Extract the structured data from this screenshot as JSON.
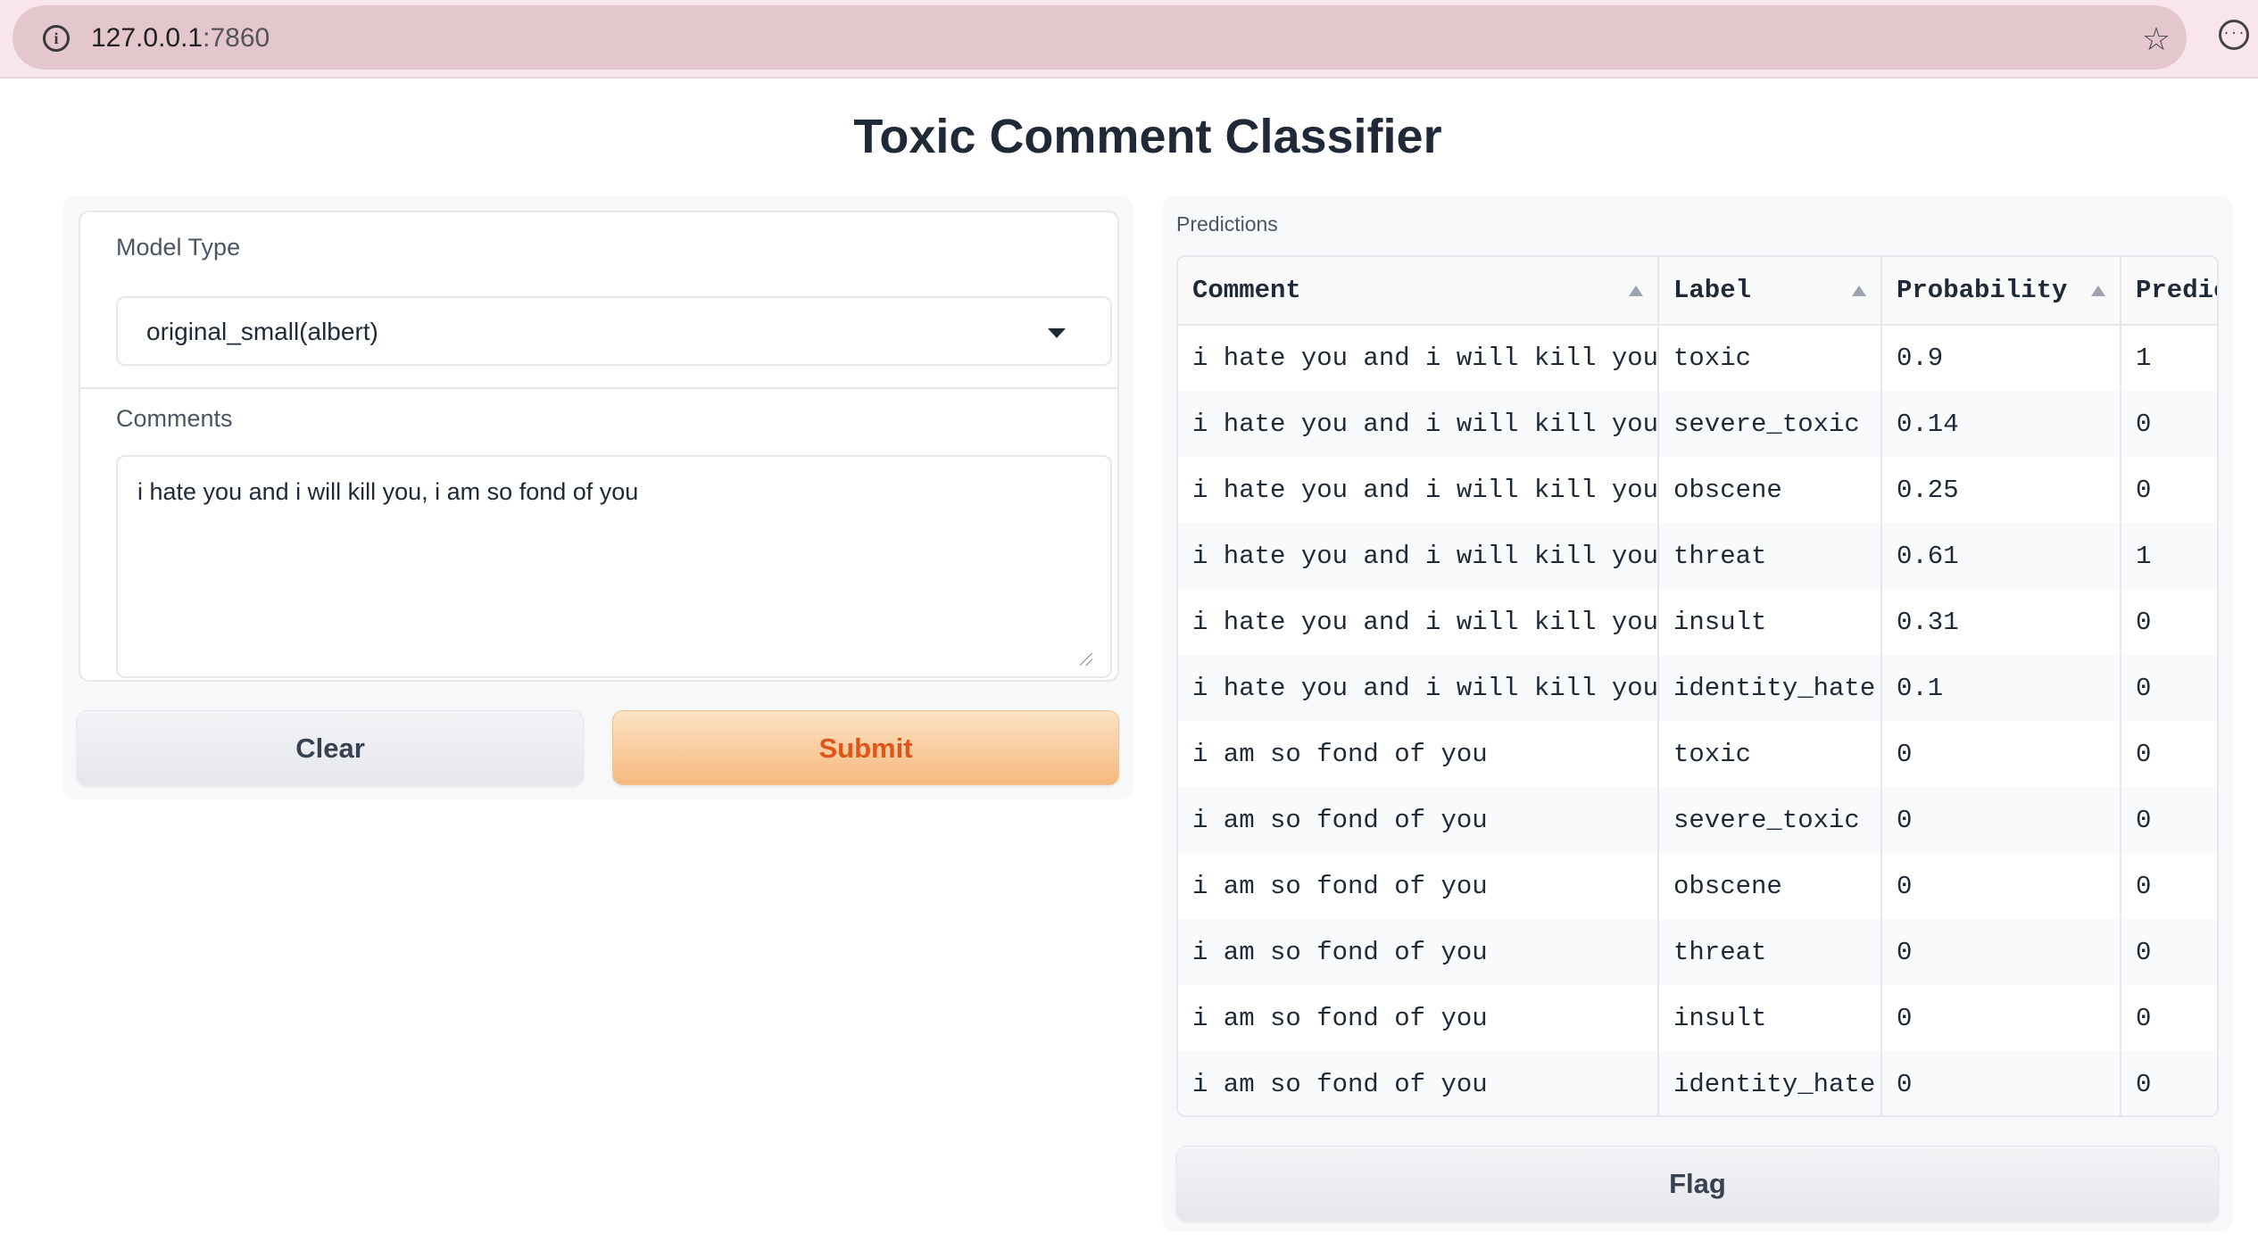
{
  "browser": {
    "url_host": "127.0.0.1",
    "url_port": ":7860"
  },
  "app": {
    "title": "Toxic Comment Classifier"
  },
  "form": {
    "model_label": "Model Type",
    "model_value": "original_small(albert)",
    "comments_label": "Comments",
    "comments_value": "i hate you and i will kill you, i am so fond of you",
    "clear_label": "Clear",
    "submit_label": "Submit"
  },
  "predictions": {
    "label": "Predictions",
    "columns": [
      "Comment",
      "Label",
      "Probability",
      "Predic"
    ],
    "rows": [
      [
        "i hate you and i will kill you",
        "toxic",
        "0.9",
        "1"
      ],
      [
        "i hate you and i will kill you",
        "severe_toxic",
        "0.14",
        "0"
      ],
      [
        "i hate you and i will kill you",
        "obscene",
        "0.25",
        "0"
      ],
      [
        "i hate you and i will kill you",
        "threat",
        "0.61",
        "1"
      ],
      [
        "i hate you and i will kill you",
        "insult",
        "0.31",
        "0"
      ],
      [
        "i hate you and i will kill you",
        "identity_hate",
        "0.1",
        "0"
      ],
      [
        "i am so fond of you",
        "toxic",
        "0",
        "0"
      ],
      [
        "i am so fond of you",
        "severe_toxic",
        "0",
        "0"
      ],
      [
        "i am so fond of you",
        "obscene",
        "0",
        "0"
      ],
      [
        "i am so fond of you",
        "threat",
        "0",
        "0"
      ],
      [
        "i am so fond of you",
        "insult",
        "0",
        "0"
      ],
      [
        "i am so fond of you",
        "identity_hate",
        "0",
        "0"
      ]
    ],
    "flag_label": "Flag"
  },
  "icons": {
    "info": "info-icon",
    "star": "star-icon",
    "extension": "extension-icon",
    "dropdown": "chevron-down-icon",
    "sort": "sort-arrow-icon"
  },
  "colors": {
    "submit_text": "#e0551b",
    "submit_bg": "#f5b97e",
    "browser_bar": "#f9e6ea"
  }
}
